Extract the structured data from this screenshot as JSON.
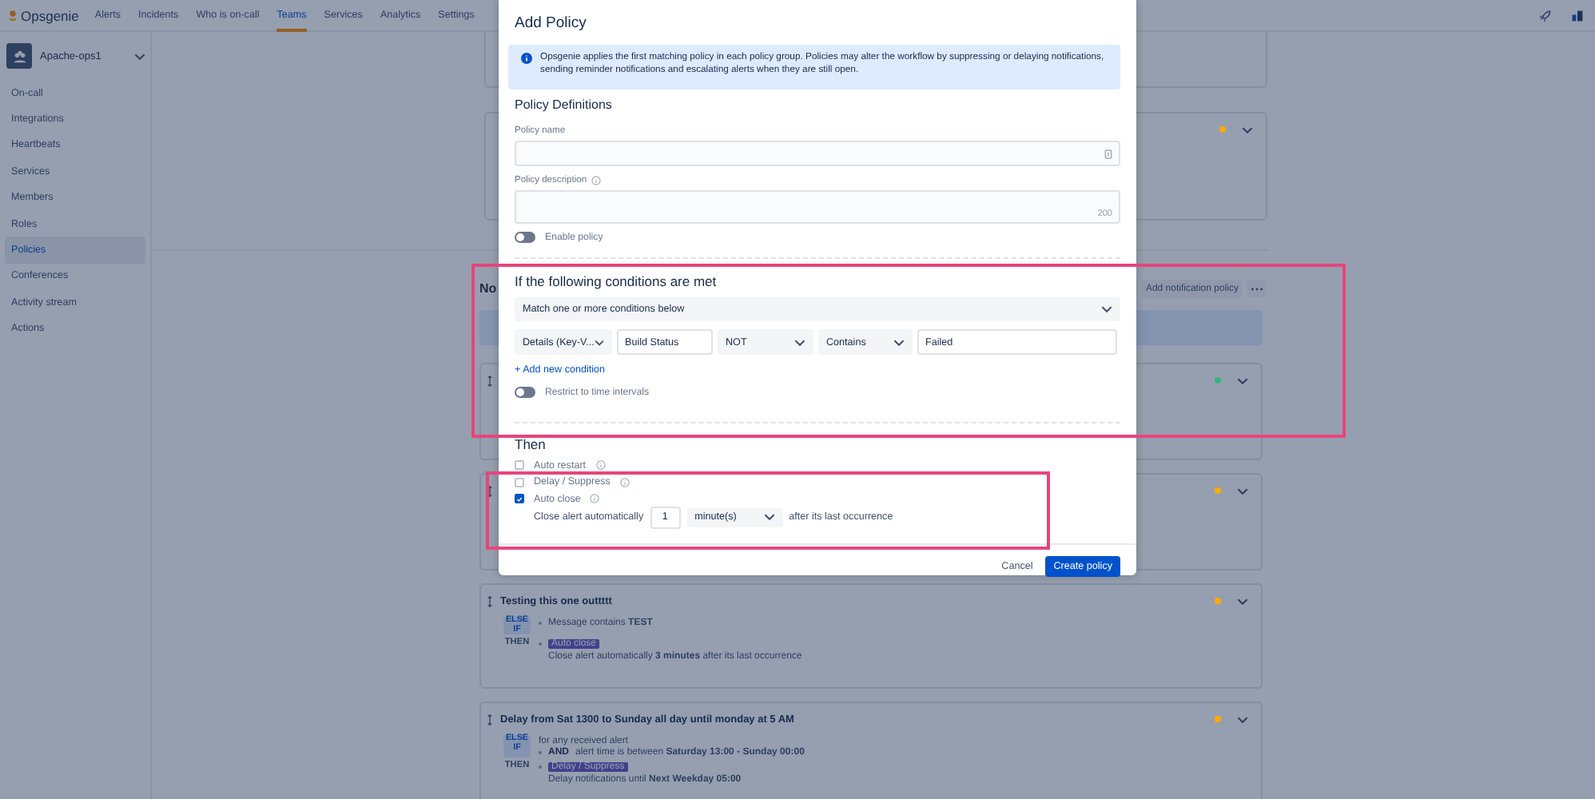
{
  "nav": {
    "logo": "Opsgenie",
    "items": [
      {
        "label": "Alerts",
        "selected": false
      },
      {
        "label": "Incidents",
        "selected": false
      },
      {
        "label": "Who is on-call",
        "selected": false
      },
      {
        "label": "Teams",
        "selected": true
      },
      {
        "label": "Services",
        "selected": false
      },
      {
        "label": "Analytics",
        "selected": false
      },
      {
        "label": "Settings",
        "selected": false
      }
    ]
  },
  "sidebar": {
    "team": "Apache-ops1",
    "items": [
      {
        "label": "On-call",
        "selected": false
      },
      {
        "label": "Integrations",
        "selected": false
      },
      {
        "label": "Heartbeats",
        "selected": false
      },
      {
        "label": "Services",
        "selected": false
      },
      {
        "label": "Members",
        "selected": false
      },
      {
        "label": "Roles",
        "selected": false
      },
      {
        "label": "Policies",
        "selected": true
      },
      {
        "label": "Conferences",
        "selected": false
      },
      {
        "label": "Activity stream",
        "selected": false
      },
      {
        "label": "Actions",
        "selected": false
      }
    ]
  },
  "alert_policies": [
    {
      "color": "#ffab00"
    }
  ],
  "notification_policies": {
    "heading": "No",
    "add_button": "Add notification policy",
    "cards": [
      {
        "color": "#36b37e"
      },
      {
        "color": "#ffab00"
      },
      {
        "color": "#ffab00",
        "title": "Testing this one outtttt",
        "condition_label": "ELSE IF",
        "conditions": [
          {
            "kind": "bullet",
            "text": "Message contains **TEST**"
          }
        ],
        "action_label": "THEN",
        "action": "Auto close",
        "action_detail": "Close alert automatically **3 minutes** after its last occurrence"
      },
      {
        "color": "#ffab00",
        "title": "Delay from Sat 1300 to Sunday all day until monday at 5 AM",
        "condition_label": "ELSE IF",
        "conditions": [
          {
            "kind": "plain",
            "text": "for any received alert"
          },
          {
            "kind": "bullet",
            "connector": "AND",
            "text": "alert time is between **Saturday 13:00 - Sunday 00:00**"
          }
        ],
        "action_label": "THEN",
        "action": "Delay / Suppress",
        "action_detail": "Delay notifications until **Next Weekday 05:00**"
      }
    ]
  },
  "modal": {
    "title": "Add Policy",
    "info": "Opsgenie applies the first matching policy in each policy group. Policies may alter the workflow by suppressing or delaying notifications, sending reminder notifications and escalating alerts when they are still open.",
    "definitions": {
      "heading": "Policy Definitions",
      "name_label": "Policy name",
      "description_label": "Policy description",
      "char_limit": "200",
      "enable_label": "Enable policy",
      "enabled": false
    },
    "conditions": {
      "heading": "If the following conditions are met",
      "match": "Match one or more conditions below",
      "fields": [
        {
          "kind": "select",
          "value": "Details (Key-V..."
        },
        {
          "kind": "input",
          "value": "Build Status"
        },
        {
          "kind": "select",
          "value": "NOT"
        },
        {
          "kind": "select",
          "value": "Contains"
        },
        {
          "kind": "input",
          "value": "Failed"
        }
      ],
      "add_link": "+ Add new condition",
      "restrict_label": "Restrict to time intervals",
      "restrict_on": false
    },
    "then": {
      "heading": "Then",
      "actions": [
        {
          "label": "Auto restart",
          "checked": false
        },
        {
          "label": "Delay / Suppress",
          "checked": false
        },
        {
          "label": "Auto close",
          "checked": true,
          "prefix": "Close alert automatically",
          "amount": "1",
          "unit": "minute(s)",
          "suffix": "after its last occurrence"
        }
      ]
    },
    "cancel": "Cancel",
    "create": "Create policy"
  }
}
